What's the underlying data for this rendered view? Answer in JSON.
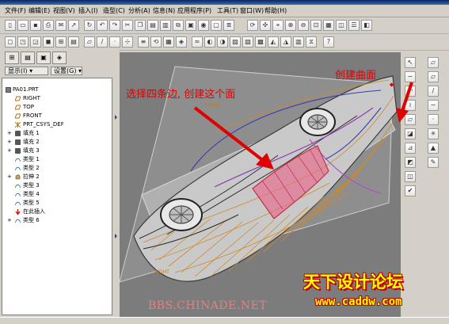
{
  "menu": [
    "文件(F)",
    "编辑(E)",
    "视图(V)",
    "插入(I)",
    "造型(C)",
    "分析(A)",
    "信息(N)",
    "应用程序(P)",
    "工具(T)",
    "窗口(W)",
    "帮助(H)"
  ],
  "left_panel": {
    "show_label": "显示(I) ▾",
    "settings_label": "设置(G) ▾"
  },
  "tree": [
    {
      "label": "PA01.PRT",
      "icon": "part-icon"
    },
    {
      "label": "RIGHT",
      "icon": "datum-plane-icon"
    },
    {
      "label": "TOP",
      "icon": "datum-plane-icon"
    },
    {
      "label": "FRONT",
      "icon": "datum-plane-icon"
    },
    {
      "label": "PRT_CSYS_DEF",
      "icon": "coordinate-system-icon"
    },
    {
      "label": "填充 1",
      "icon": "fill-surface-icon",
      "expand": "+"
    },
    {
      "label": "填充 2",
      "icon": "fill-surface-icon",
      "expand": "+"
    },
    {
      "label": "填充 3",
      "icon": "fill-surface-icon",
      "expand": "+"
    },
    {
      "label": "类型 1",
      "icon": "style-feature-icon"
    },
    {
      "label": "类型 2",
      "icon": "style-feature-icon"
    },
    {
      "label": "拉伸 2",
      "icon": "extrude-icon",
      "expand": "+"
    },
    {
      "label": "类型 3",
      "icon": "style-feature-icon"
    },
    {
      "label": "类型 4",
      "icon": "style-feature-icon"
    },
    {
      "label": "类型 5",
      "icon": "style-feature-icon"
    },
    {
      "label": "在此插入",
      "icon": "insert-here-arrow-icon"
    },
    {
      "label": "类型 6",
      "icon": "style-feature-icon",
      "expand": "+"
    }
  ],
  "model_labels": {
    "front": "FRONT",
    "right": "RIGHT"
  },
  "annotations": {
    "select_edges": "选择四条边, 创建这个面",
    "create_surface": "创建曲面"
  },
  "watermark": {
    "site_title": "天下设计论坛",
    "site_url": "www.caddw.com",
    "bbs": "BBS.CHINADE.NET"
  },
  "colors": {
    "annotation_red": "#e00000",
    "surface_pink": "#e86a8a",
    "wire_orange": "#d08a2a",
    "viewport_bg": "#7c7c7c",
    "watermark_yellow": "#ffff00"
  }
}
